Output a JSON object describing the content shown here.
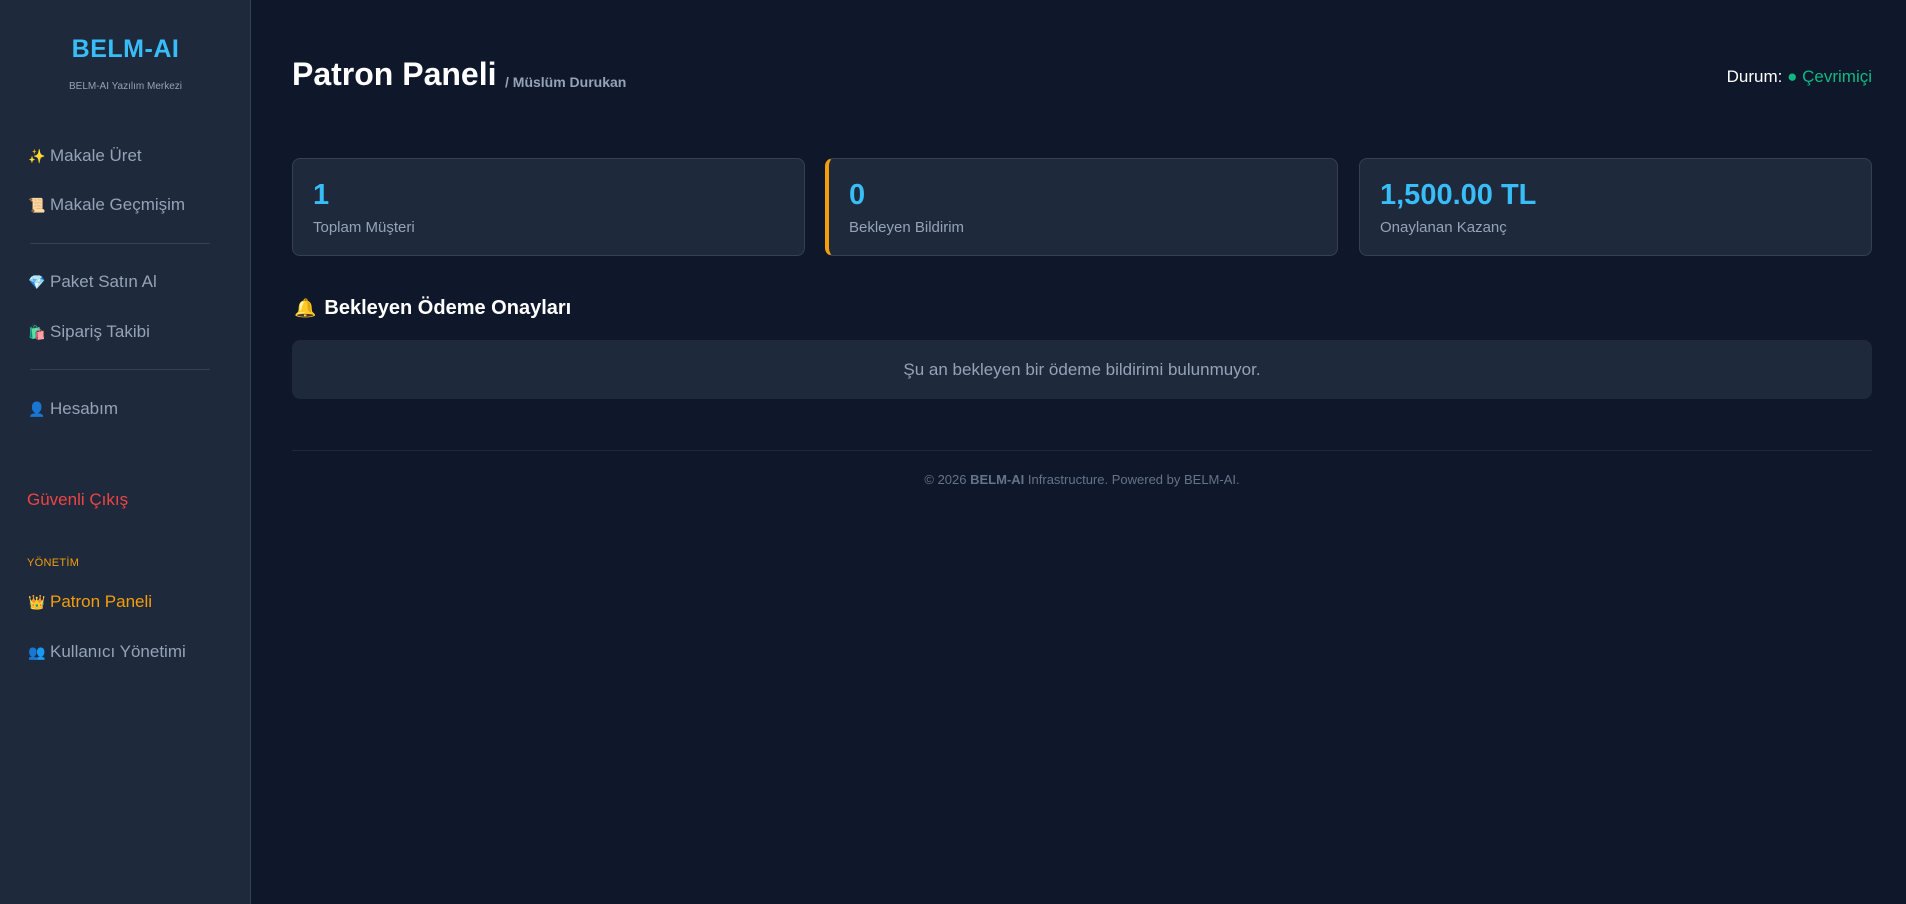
{
  "sidebar": {
    "brand": "BELM-AI",
    "brand_sub": "BELM-AI Yazılım Merkezi",
    "items": [
      {
        "icon": "✨",
        "label": "Makale Üret"
      },
      {
        "icon": "📜",
        "label": "Makale Geçmişim"
      },
      {
        "icon": "💎",
        "label": "Paket Satın Al"
      },
      {
        "icon": "🛍️",
        "label": "Sipariş Takibi"
      },
      {
        "icon": "👤",
        "label": "Hesabım"
      }
    ],
    "logout": "Güvenli Çıkış",
    "admin_section_label": "YÖNETİM",
    "admin_items": [
      {
        "icon": "👑",
        "label": "Patron Paneli"
      },
      {
        "icon": "👥",
        "label": "Kullanıcı Yönetimi"
      }
    ]
  },
  "header": {
    "title": "Patron Paneli",
    "subtitle": "/ Müslüm Durukan",
    "status_label": "Durum:",
    "status_dot": "●",
    "status_value": "Çevrimiçi"
  },
  "stats": [
    {
      "value": "1",
      "label": "Toplam Müşteri"
    },
    {
      "value": "0",
      "label": "Bekleyen Bildirim"
    },
    {
      "value": "1,500.00 TL",
      "label": "Onaylanan Kazanç"
    }
  ],
  "pending": {
    "icon": "🔔",
    "title": "Bekleyen Ödeme Onayları",
    "empty_message": "Şu an bekleyen bir ödeme bildirimi bulunmuyor."
  },
  "footer": {
    "prefix": "© 2026 ",
    "brand": "BELM-AI",
    "suffix": " Infrastructure. Powered by BELM-AI."
  },
  "colors": {
    "background": "#0f172a",
    "sidebar": "#1e293b",
    "accent": "#38bdf8",
    "warning": "#f59e0b",
    "danger": "#ef4444",
    "online": "#10b981"
  }
}
